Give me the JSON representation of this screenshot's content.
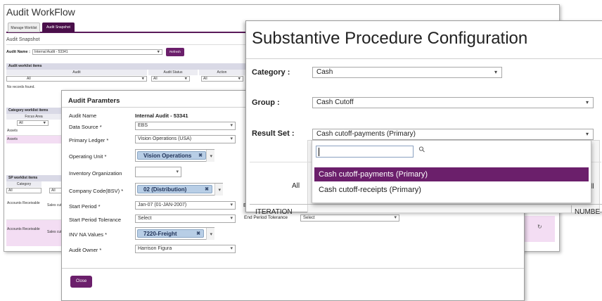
{
  "workflow": {
    "title": "Audit WorkFlow",
    "tabs": [
      "Manage Worklist",
      "Audit Snapshot"
    ],
    "active_tab": "Audit Snapshot",
    "snapshot_heading": "Audit Snapshot",
    "audit_name_label": "Audit Name :",
    "audit_name_value": "Internal Audit - 53341",
    "refresh_label": "Refresh",
    "audit_items": {
      "header": "Audit worklist items",
      "columns": [
        "Audit",
        "Audit Status",
        "Action"
      ],
      "filters": [
        "All",
        "All",
        "All"
      ],
      "empty": "No records found."
    },
    "category_items": {
      "header": "Category worklist items",
      "column": "Focus Area",
      "filter": "All",
      "rows": [
        "Assets",
        "Assets"
      ]
    },
    "sp_items": {
      "header": "SP worklist items",
      "column": "Category",
      "filters": [
        "All",
        "All"
      ],
      "rows": [
        {
          "category": "Accounts Receivable",
          "detail": "Sales cut"
        },
        {
          "category": "Accounts Receivable",
          "detail": "Sales cut"
        }
      ]
    }
  },
  "params": {
    "title": "Audit Paramters",
    "fields": {
      "audit_name": {
        "label": "Audit Name",
        "value": "Internal Audit - 53341"
      },
      "data_source": {
        "label": "Data Source *",
        "value": "EBS"
      },
      "primary_ledger": {
        "label": "Primary Ledger *",
        "value": "Vision Operations (USA)"
      },
      "operating_unit": {
        "label": "Operating Unit *",
        "value": "Vision Operations"
      },
      "inventory_org": {
        "label": "Inventory Organization",
        "value": ""
      },
      "company_code": {
        "label": "Company Code(BSV) *",
        "value": "02 (Distribution)"
      },
      "start_period": {
        "label": "Start Period *",
        "value": "Jan-07 (01-JAN-2007)"
      },
      "start_tolerance": {
        "label": "Start Period Tolerance",
        "value": "Select"
      },
      "end_tolerance": {
        "label": "End Period Tolerance",
        "value": "Select"
      },
      "inv_na": {
        "label": "INV NA Values *",
        "value": "7220-Freight"
      },
      "audit_owner": {
        "label": "Audit Owner *",
        "value": "Harrison Figura"
      }
    },
    "close_label": "Close",
    "partial_label": "E"
  },
  "config": {
    "title": "Substantive Procedure Configuration",
    "category": {
      "label": "Category :",
      "value": "Cash"
    },
    "group": {
      "label": "Group :",
      "value": "Cash Cutoff"
    },
    "result_set": {
      "label": "Result Set :",
      "value": "Cash cutoff-payments (Primary)"
    },
    "search_placeholder": "",
    "options": [
      "Cash cutoff-payments (Primary)",
      "Cash cutoff-receipts (Primary)"
    ],
    "selected_option": "Cash cutoff-payments (Primary)",
    "table": {
      "filter_all": "All",
      "col_iteration": "ITERATION",
      "col_number": "NUMBE",
      "col_ll": "ll"
    }
  },
  "colors": {
    "accent": "#6b1f6b",
    "chip": "#b8cee6"
  }
}
